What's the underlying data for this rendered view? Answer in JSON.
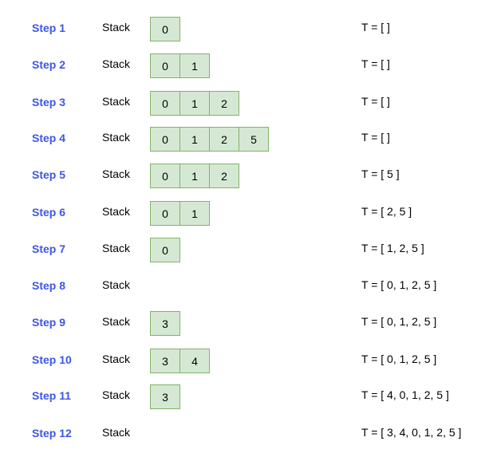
{
  "stack_label": "Stack",
  "colors": {
    "step_label": "#3d56e6",
    "cell_fill": "#d5e8d4",
    "cell_border": "#82b366"
  },
  "steps": [
    {
      "label": "Step 1",
      "stack": [
        "0"
      ],
      "t": "T = [ ]"
    },
    {
      "label": "Step 2",
      "stack": [
        "0",
        "1"
      ],
      "t": "T = [ ]"
    },
    {
      "label": "Step 3",
      "stack": [
        "0",
        "1",
        "2"
      ],
      "t": "T = [ ]"
    },
    {
      "label": "Step 4",
      "stack": [
        "0",
        "1",
        "2",
        "5"
      ],
      "t": "T = [ ]"
    },
    {
      "label": "Step 5",
      "stack": [
        "0",
        "1",
        "2"
      ],
      "t": "T = [ 5 ]"
    },
    {
      "label": "Step 6",
      "stack": [
        "0",
        "1"
      ],
      "t": "T = [ 2, 5 ]"
    },
    {
      "label": "Step 7",
      "stack": [
        "0"
      ],
      "t": "T = [ 1, 2, 5 ]"
    },
    {
      "label": "Step 8",
      "stack": [],
      "t": "T = [ 0, 1, 2, 5 ]"
    },
    {
      "label": "Step 9",
      "stack": [
        "3"
      ],
      "t": "T = [ 0, 1, 2, 5 ]"
    },
    {
      "label": "Step 10",
      "stack": [
        "3",
        "4"
      ],
      "t": "T = [ 0, 1, 2, 5 ]"
    },
    {
      "label": "Step 11",
      "stack": [
        "3"
      ],
      "t": "T = [ 4, 0, 1, 2, 5 ]"
    },
    {
      "label": "Step 12",
      "stack": [],
      "t": "T = [ 3, 4, 0, 1, 2, 5 ]"
    }
  ]
}
